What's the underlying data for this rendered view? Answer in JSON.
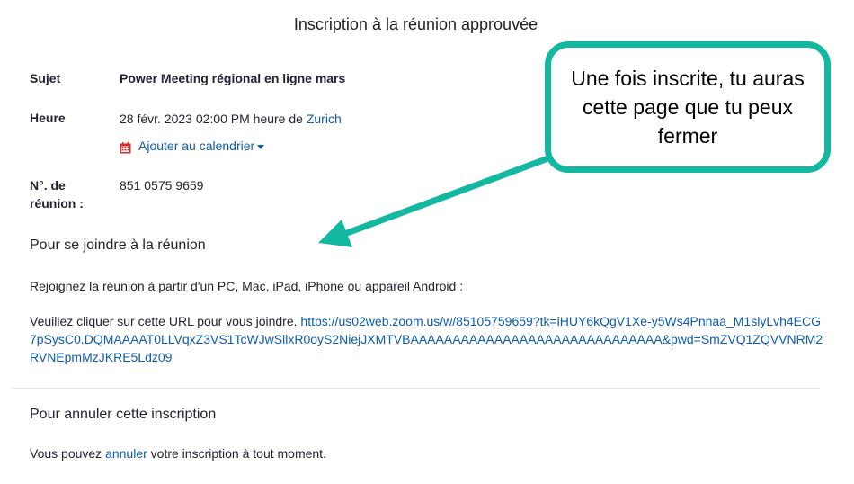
{
  "header": {
    "title": "Inscription à la réunion approuvée"
  },
  "details": {
    "topic_label": "Sujet",
    "topic_value": "Power Meeting régional en ligne mars",
    "time_label": "Heure",
    "time_value": "28 févr. 2023 02:00 PM heure de",
    "time_zone_link": "Zurich",
    "calendar_label": "Ajouter au calendrier",
    "meeting_id_label_line1": "N°. de",
    "meeting_id_label_line2": "réunion :",
    "meeting_id_value": "851 0575 9659"
  },
  "join": {
    "section_title": "Pour se joindre à la réunion",
    "intro": "Rejoignez la réunion à partir d'un PC, Mac, iPad, iPhone ou appareil Android :",
    "url_prefix": "Veuillez cliquer sur cette URL pour vous joindre.",
    "url": "https://us02web.zoom.us/w/85105759659?tk=iHUY6kQgV1Xe-y5Ws4Pnnaa_M1slyLvh4ECG7pSysC0.DQMAAAAT0LLVqxZ3VS1TcWJwSllxR0oyS2NiejJXMTVBAAAAAAAAAAAAAAAAAAAAAAAAAAAAAA&pwd=SmZVQ1ZQVVNRM2RVNEpmMzJKRE5Ldz09"
  },
  "cancel": {
    "section_title": "Pour annuler cette inscription",
    "text_before": "Vous pouvez",
    "link_label": "annuler",
    "text_after": "votre inscription à tout moment."
  },
  "annotation": {
    "callout_text": "Une fois inscrite, tu auras cette page que tu peux fermer",
    "color": "#14b8a0"
  },
  "colors": {
    "link": "#0e5cad",
    "calendar_icon": "#d0312d"
  },
  "icons": {
    "calendar": "calendar-icon",
    "dropdown": "chevron-down-icon",
    "arrow": "arrow-icon"
  }
}
